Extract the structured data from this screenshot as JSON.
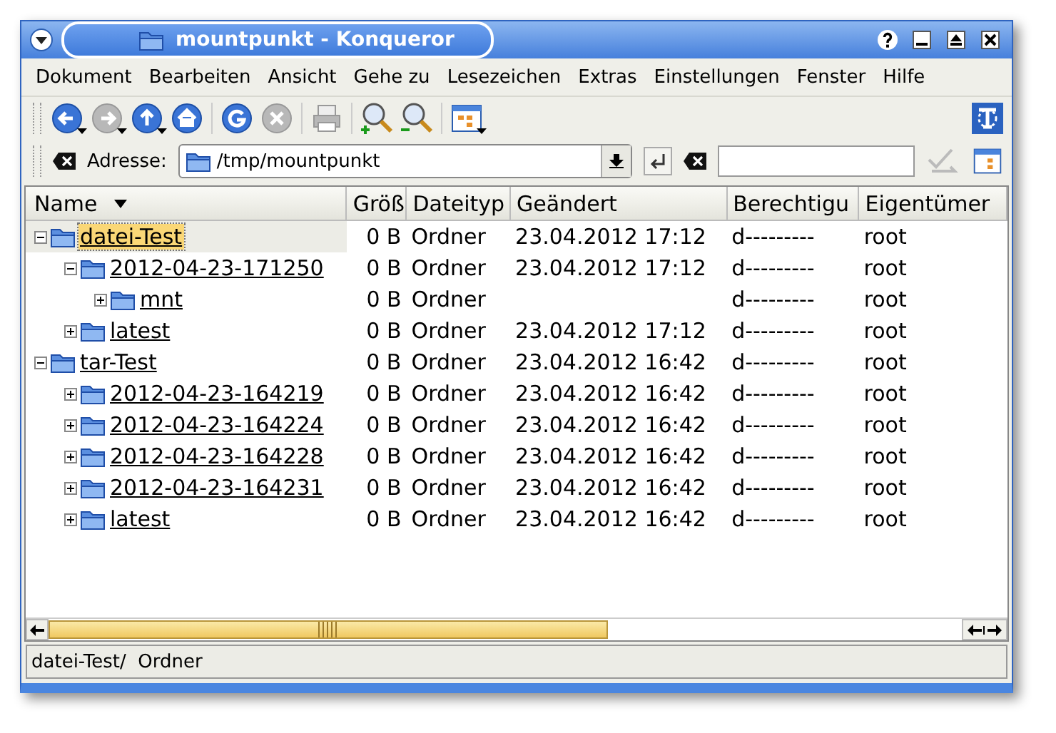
{
  "window": {
    "title": "mountpunkt - Konqueror"
  },
  "menu": [
    "Dokument",
    "Bearbeiten",
    "Ansicht",
    "Gehe zu",
    "Lesezeichen",
    "Extras",
    "Einstellungen",
    "Fenster",
    "Hilfe"
  ],
  "toolbar": [
    {
      "kind": "back",
      "disabled": false,
      "dropdown": true
    },
    {
      "kind": "forward",
      "disabled": true,
      "dropdown": true
    },
    {
      "kind": "up",
      "disabled": false,
      "dropdown": true
    },
    {
      "kind": "home",
      "disabled": false,
      "dropdown": false
    },
    {
      "kind": "reload",
      "disabled": false,
      "dropdown": false
    },
    {
      "kind": "stop",
      "disabled": true,
      "dropdown": false
    },
    {
      "kind": "print",
      "disabled": true,
      "dropdown": false
    },
    {
      "kind": "zoom-in",
      "disabled": false,
      "dropdown": false
    },
    {
      "kind": "zoom-out",
      "disabled": false,
      "dropdown": false
    },
    {
      "kind": "view",
      "disabled": false,
      "dropdown": true
    }
  ],
  "location": {
    "label": "Adresse:",
    "value": "/tmp/mountpunkt"
  },
  "table": {
    "columns": [
      "Name",
      "Größ",
      "Dateityp",
      "Geändert",
      "Berechtigu",
      "Eigentümer"
    ],
    "rows": [
      {
        "name": "datei-Test",
        "size": "0 B",
        "type": "Ordner",
        "modified": "23.04.2012 17:12",
        "permissions": "d---------",
        "owner": "root",
        "selected": true,
        "expanded": true,
        "children": [
          {
            "name": "2012-04-23-171250",
            "size": "0 B",
            "type": "Ordner",
            "modified": "23.04.2012 17:12",
            "permissions": "d---------",
            "owner": "root",
            "selected": false,
            "expanded": true,
            "children": [
              {
                "name": "mnt",
                "size": "0 B",
                "type": "Ordner",
                "permissions": "d---------",
                "owner": "root",
                "selected": false,
                "expanded": false
              }
            ]
          },
          {
            "name": "latest",
            "size": "0 B",
            "type": "Ordner",
            "modified": "23.04.2012 17:12",
            "permissions": "d---------",
            "owner": "root",
            "selected": false,
            "expanded": false
          }
        ]
      },
      {
        "name": "tar-Test",
        "size": "0 B",
        "type": "Ordner",
        "modified": "23.04.2012 16:42",
        "permissions": "d---------",
        "owner": "root",
        "selected": false,
        "expanded": true,
        "children": [
          {
            "name": "2012-04-23-164219",
            "size": "0 B",
            "type": "Ordner",
            "modified": "23.04.2012 16:42",
            "permissions": "d---------",
            "owner": "root",
            "selected": false,
            "expanded": false
          },
          {
            "name": "2012-04-23-164224",
            "size": "0 B",
            "type": "Ordner",
            "modified": "23.04.2012 16:42",
            "permissions": "d---------",
            "owner": "root",
            "selected": false,
            "expanded": false
          },
          {
            "name": "2012-04-23-164228",
            "size": "0 B",
            "type": "Ordner",
            "modified": "23.04.2012 16:42",
            "permissions": "d---------",
            "owner": "root",
            "selected": false,
            "expanded": false
          },
          {
            "name": "2012-04-23-164231",
            "size": "0 B",
            "type": "Ordner",
            "modified": "23.04.2012 16:42",
            "permissions": "d---------",
            "owner": "root",
            "selected": false,
            "expanded": false
          },
          {
            "name": "latest",
            "size": "0 B",
            "type": "Ordner",
            "modified": "23.04.2012 16:42",
            "permissions": "d---------",
            "owner": "root",
            "selected": false,
            "expanded": false
          }
        ]
      }
    ]
  },
  "status_bar": "datei-Test/  Ordner"
}
